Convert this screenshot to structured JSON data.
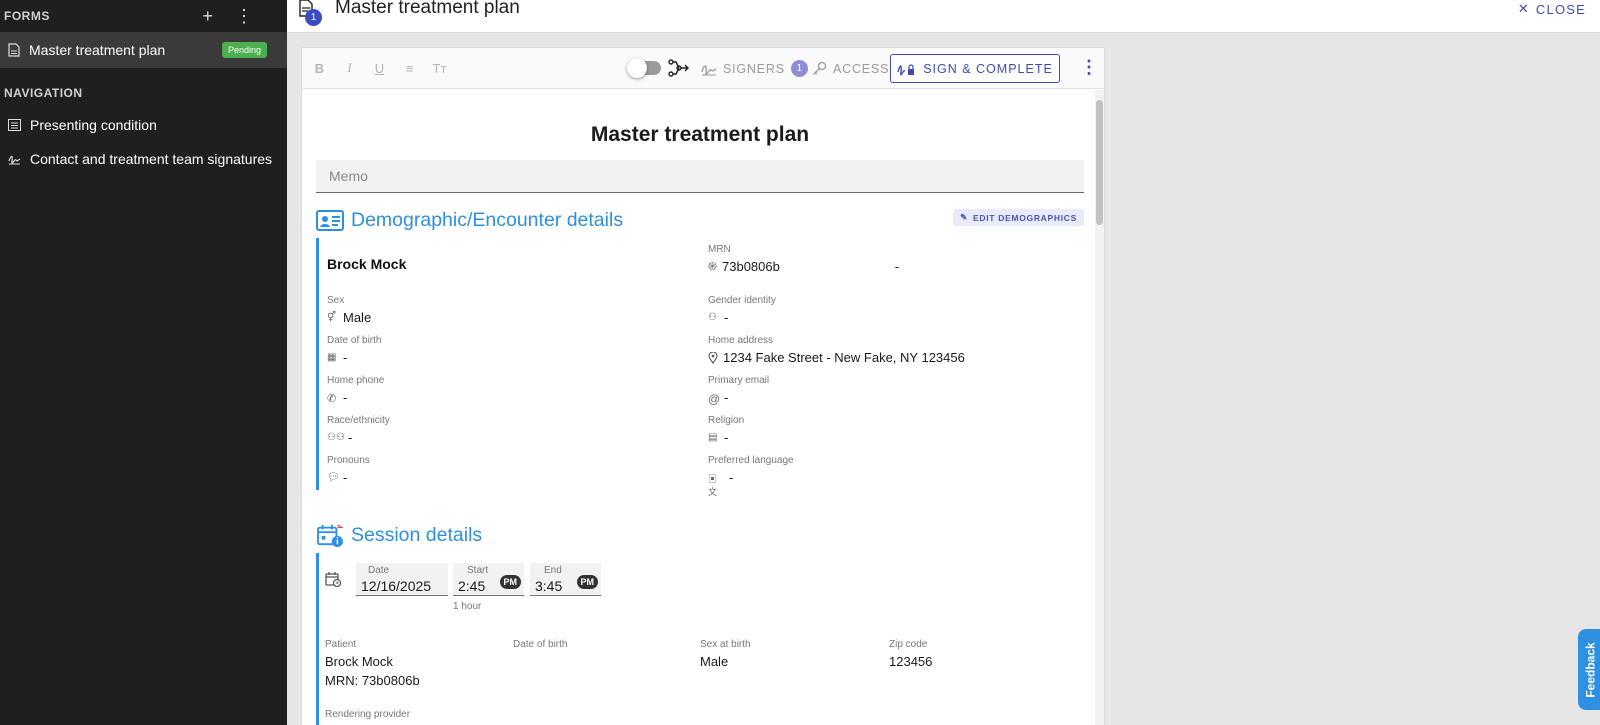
{
  "sidebar": {
    "forms_label": "FORMS",
    "form_item": {
      "name": "Master treatment plan",
      "status": "Pending"
    },
    "navigation_label": "NAVIGATION",
    "nav_items": [
      {
        "label": "Presenting condition"
      },
      {
        "label": "Contact and treatment team signatures"
      }
    ]
  },
  "topbar": {
    "title": "Master treatment plan",
    "badge_count": "1",
    "close_label": "CLOSE"
  },
  "toolbar": {
    "format_buttons": [
      "B",
      "I",
      "U",
      "≡",
      "Tт"
    ],
    "signers_label": "SIGNERS",
    "signers_count": "1",
    "access_label": "ACCESS",
    "sign_label": "SIGN & COMPLETE"
  },
  "document": {
    "title": "Master treatment plan",
    "memo_placeholder": "Memo",
    "demographics": {
      "section_title": "Demographic/Encounter details",
      "edit_label": "EDIT DEMOGRAPHICS",
      "patient_name": "Brock Mock",
      "mrn_label": "MRN",
      "mrn_value": "73b0806b",
      "mrn_extra": "-",
      "sex_label": "Sex",
      "sex_value": "Male",
      "gender_label": "Gender identity",
      "gender_value": "-",
      "dob_label": "Date of birth",
      "dob_value": "-",
      "address_label": "Home address",
      "address_value": "1234 Fake Street - New Fake, NY 123456",
      "phone_label": "Home phone",
      "phone_value": "-",
      "email_label": "Primary email",
      "email_value": "-",
      "race_label": "Race/ethnicity",
      "race_value": "-",
      "religion_label": "Religion",
      "religion_value": "-",
      "pronouns_label": "Pronouns",
      "pronouns_value": "-",
      "language_label": "Preferred language",
      "language_value": "-"
    },
    "session": {
      "section_title": "Session details",
      "date_label": "Date",
      "date_value": "12/16/2025",
      "start_label": "Start",
      "start_value": "2:45",
      "start_ampm": "PM",
      "end_label": "End",
      "end_value": "3:45",
      "end_ampm": "PM",
      "duration": "1 hour",
      "patient_label": "Patient",
      "patient_value": "Brock Mock",
      "patient_mrn": "MRN: 73b0806b",
      "dob_label": "Date of birth",
      "sex_birth_label": "Sex at birth",
      "sex_birth_value": "Male",
      "zip_label": "Zip code",
      "zip_value": "123456",
      "rendering_label": "Rendering provider"
    }
  },
  "feedback_label": "Feedback",
  "colors": {
    "accent": "#2f8fe0",
    "primary": "#3f4bb5",
    "pending": "#4caf50",
    "sidebar_bg": "#1f1f1f"
  }
}
